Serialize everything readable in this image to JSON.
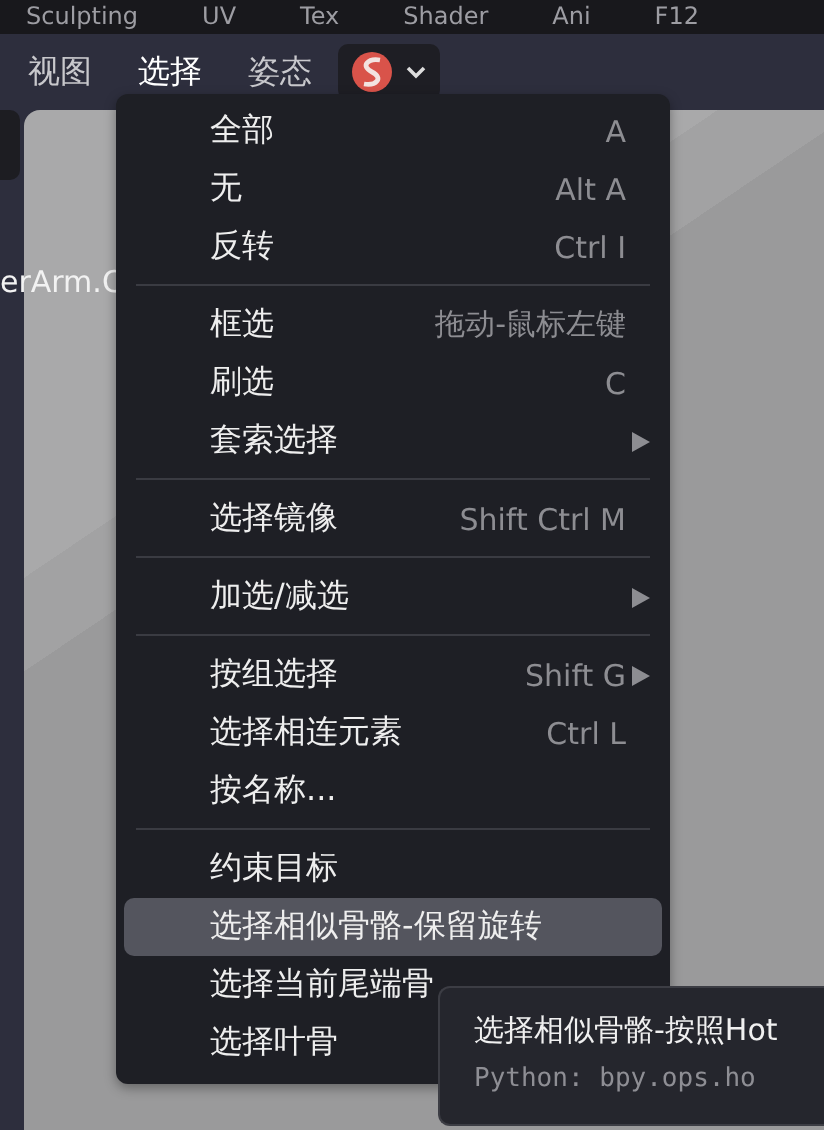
{
  "workspace_tabs": [
    "Sculpting",
    "UV",
    "Tex",
    "Shader",
    "Ani",
    "F12"
  ],
  "header_menus": [
    {
      "label": "视图",
      "selected": false
    },
    {
      "label": "选择",
      "selected": true
    },
    {
      "label": "姿态",
      "selected": false
    }
  ],
  "object_label": "erArm.C",
  "menu": {
    "groups": [
      [
        {
          "label": "全部",
          "shortcut": "A",
          "submenu": false,
          "selected": false
        },
        {
          "label": "无",
          "shortcut": "Alt A",
          "submenu": false,
          "selected": false
        },
        {
          "label": "反转",
          "shortcut": "Ctrl I",
          "submenu": false,
          "selected": false
        }
      ],
      [
        {
          "label": "框选",
          "shortcut": "拖动-鼠标左键",
          "submenu": false,
          "selected": false
        },
        {
          "label": "刷选",
          "shortcut": "C",
          "submenu": false,
          "selected": false
        },
        {
          "label": "套索选择",
          "submenu": true,
          "selected": false
        }
      ],
      [
        {
          "label": "选择镜像",
          "shortcut": "Shift Ctrl M",
          "submenu": false,
          "selected": false
        }
      ],
      [
        {
          "label": "加选/减选",
          "submenu": true,
          "selected": false
        }
      ],
      [
        {
          "label": "按组选择",
          "shortcut": "Shift G",
          "submenu": true,
          "selected": false
        },
        {
          "label": "选择相连元素",
          "shortcut": "Ctrl L",
          "submenu": false,
          "selected": false
        },
        {
          "label": "按名称...",
          "submenu": false,
          "selected": false
        }
      ],
      [
        {
          "label": "约束目标",
          "submenu": false,
          "selected": false
        },
        {
          "label": "选择相似骨骼-保留旋转",
          "submenu": false,
          "selected": true
        },
        {
          "label": "选择当前尾端骨",
          "submenu": false,
          "selected": false
        },
        {
          "label": "选择叶骨",
          "submenu": false,
          "selected": false
        }
      ]
    ]
  },
  "tooltip": {
    "title": "选择相似骨骼-按照Hot",
    "python": "Python: bpy.ops.ho"
  }
}
